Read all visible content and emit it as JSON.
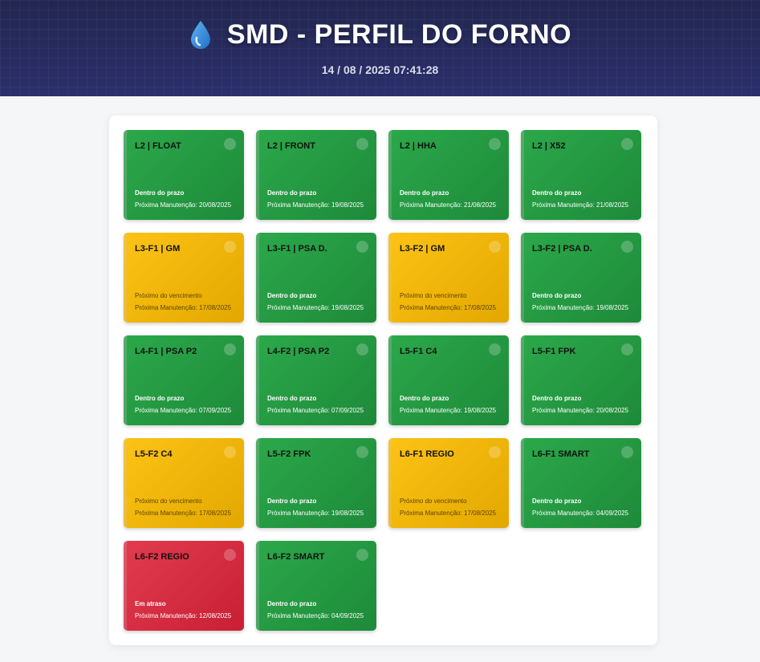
{
  "header": {
    "title": "SMD - PERFIL DO FORNO",
    "datetime": "14 / 08 / 2025 07:41:28",
    "icon": "water-drop-icon"
  },
  "colors": {
    "header_bg": "#262a5e",
    "ok": "#2ba84a",
    "warning": "#fcc214",
    "late": "#e23a4e"
  },
  "cards": [
    {
      "name": "L2 | FLOAT",
      "status": "Dentro do prazo",
      "next": "Próxima Manutenção: 20/08/2025",
      "state": "green"
    },
    {
      "name": "L2 | FRONT",
      "status": "Dentro do prazo",
      "next": "Próxima Manutenção: 19/08/2025",
      "state": "green"
    },
    {
      "name": "L2 | HHA",
      "status": "Dentro do prazo",
      "next": "Próxima Manutenção: 21/08/2025",
      "state": "green"
    },
    {
      "name": "L2 | X52",
      "status": "Dentro do prazo",
      "next": "Próxima Manutenção: 21/08/2025",
      "state": "green"
    },
    {
      "name": "L3-F1 | GM",
      "status": "Próximo do vencimento",
      "next": "Próxima Manutenção: 17/08/2025",
      "state": "yellow"
    },
    {
      "name": "L3-F1 | PSA D.",
      "status": "Dentro do prazo",
      "next": "Próxima Manutenção: 19/08/2025",
      "state": "green"
    },
    {
      "name": "L3-F2 | GM",
      "status": "Próximo do vencimento",
      "next": "Próxima Manutenção: 17/08/2025",
      "state": "yellow"
    },
    {
      "name": "L3-F2 | PSA D.",
      "status": "Dentro do prazo",
      "next": "Próxima Manutenção: 19/08/2025",
      "state": "green"
    },
    {
      "name": "L4-F1 | PSA P2",
      "status": "Dentro do prazo",
      "next": "Próxima Manutenção: 07/09/2025",
      "state": "green"
    },
    {
      "name": "L4-F2 | PSA P2",
      "status": "Dentro do prazo",
      "next": "Próxima Manutenção: 07/09/2025",
      "state": "green"
    },
    {
      "name": "L5-F1 C4",
      "status": "Dentro do prazo",
      "next": "Próxima Manutenção: 19/08/2025",
      "state": "green"
    },
    {
      "name": "L5-F1 FPK",
      "status": "Dentro do prazo",
      "next": "Próxima Manutenção: 20/08/2025",
      "state": "green"
    },
    {
      "name": "L5-F2 C4",
      "status": "Próximo do vencimento",
      "next": "Próxima Manutenção: 17/08/2025",
      "state": "yellow"
    },
    {
      "name": "L5-F2 FPK",
      "status": "Dentro do prazo",
      "next": "Próxima Manutenção: 19/08/2025",
      "state": "green"
    },
    {
      "name": "L6-F1 REGIO",
      "status": "Próximo do vencimento",
      "next": "Próxima Manutenção: 17/08/2025",
      "state": "yellow"
    },
    {
      "name": "L6-F1 SMART",
      "status": "Dentro do prazo",
      "next": "Próxima Manutenção: 04/09/2025",
      "state": "green"
    },
    {
      "name": "L6-F2 REGIO",
      "status": "Em atraso",
      "next": "Próxima Manutenção: 12/08/2025",
      "state": "red"
    },
    {
      "name": "L6-F2 SMART",
      "status": "Dentro do prazo",
      "next": "Próxima Manutenção: 04/09/2025",
      "state": "green"
    }
  ]
}
